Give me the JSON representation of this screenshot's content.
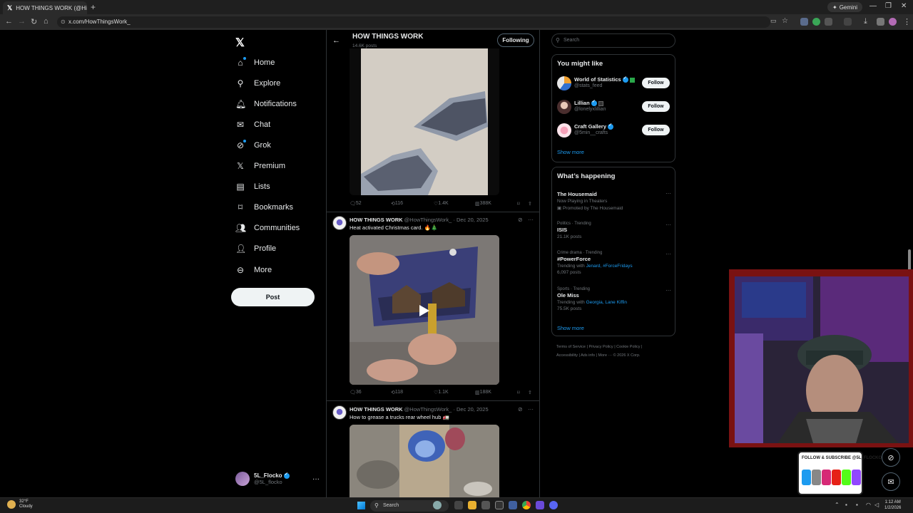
{
  "browser": {
    "tab_title": "HOW THINGS WORK (@Hi...",
    "url": "x.com/HowThingsWork_",
    "gemini_label": "Gemini"
  },
  "nav": {
    "items": [
      {
        "label": "Home",
        "icon": "home-icon"
      },
      {
        "label": "Explore",
        "icon": "search-icon"
      },
      {
        "label": "Notifications",
        "icon": "bell-icon"
      },
      {
        "label": "Chat",
        "icon": "mail-icon"
      },
      {
        "label": "Grok",
        "icon": "grok-icon"
      },
      {
        "label": "Premium",
        "icon": "x-icon"
      },
      {
        "label": "Lists",
        "icon": "list-icon"
      },
      {
        "label": "Bookmarks",
        "icon": "bookmark-icon"
      },
      {
        "label": "Communities",
        "icon": "people-icon"
      },
      {
        "label": "Profile",
        "icon": "person-icon"
      },
      {
        "label": "More",
        "icon": "more-circle-icon"
      }
    ],
    "post_label": "Post",
    "account": {
      "name": "5L_Flocko",
      "handle": "@5L_flocko"
    }
  },
  "header": {
    "title": "HOW THINGS WORK",
    "subtitle": "14.6K posts",
    "following_label": "Following"
  },
  "posts": [
    {
      "stats": {
        "replies": "52",
        "reposts": "116",
        "likes": "1.4K",
        "views": "388K"
      }
    },
    {
      "author": "HOW THINGS WORK",
      "handle": "@HowThingsWork_",
      "date": "· Dec 20, 2025",
      "text": "Heat activated Christmas card. 🔥🎄",
      "stats": {
        "replies": "36",
        "reposts": "118",
        "likes": "1.1K",
        "views": "188K"
      }
    },
    {
      "author": "HOW THINGS WORK",
      "handle": "@HowThingsWork_",
      "date": "· Dec 20, 2025",
      "text": "How to grease a trucks rear wheel hub 🚛"
    }
  ],
  "sidebar": {
    "search_placeholder": "Search",
    "you_might_like": {
      "title": "You might like",
      "accounts": [
        {
          "name": "World of Statistics",
          "handle": "@stats_feed",
          "follow": "Follow"
        },
        {
          "name": "Lillian",
          "handle": "@lonelyxlillian",
          "follow": "Follow"
        },
        {
          "name": "Craft Gallery",
          "handle": "@5min__crafts",
          "follow": "Follow"
        }
      ],
      "show_more": "Show more"
    },
    "whats_happening": {
      "title": "What’s happening",
      "trends": [
        {
          "context": "",
          "name": "The Housemaid",
          "sub": "Now Playing in Theaters",
          "sub2": "Promoted by The Housemaid"
        },
        {
          "context": "Politics · Trending",
          "name": "ISIS",
          "sub": "21.1K posts"
        },
        {
          "context": "Crime drama · Trending",
          "name": "#PowerForce",
          "sub_prefix": "Trending with ",
          "sub_links": "Jenard, #ForceFridays",
          "sub": "6,097 posts"
        },
        {
          "context": "Sports · Trending",
          "name": "Ole Miss",
          "sub_prefix": "Trending with ",
          "sub_links": "Georgia, Lane Kiffin",
          "sub": "75.5K posts"
        }
      ],
      "show_more": "Show more"
    },
    "footer_line1": "Terms of Service  |  Privacy Policy  |  Cookie Policy  |",
    "footer_line2": "Accessibility  |  Ads info  |  More ···  © 2026 X Corp."
  },
  "overlay": {
    "social_text": "FOLLOW & SUBSCRIBE @5L_FLOCKO"
  },
  "taskbar": {
    "temp": "32°F",
    "weather": "Cloudy",
    "search": "Search",
    "time": "1:12 AM",
    "date": "1/2/2026"
  }
}
